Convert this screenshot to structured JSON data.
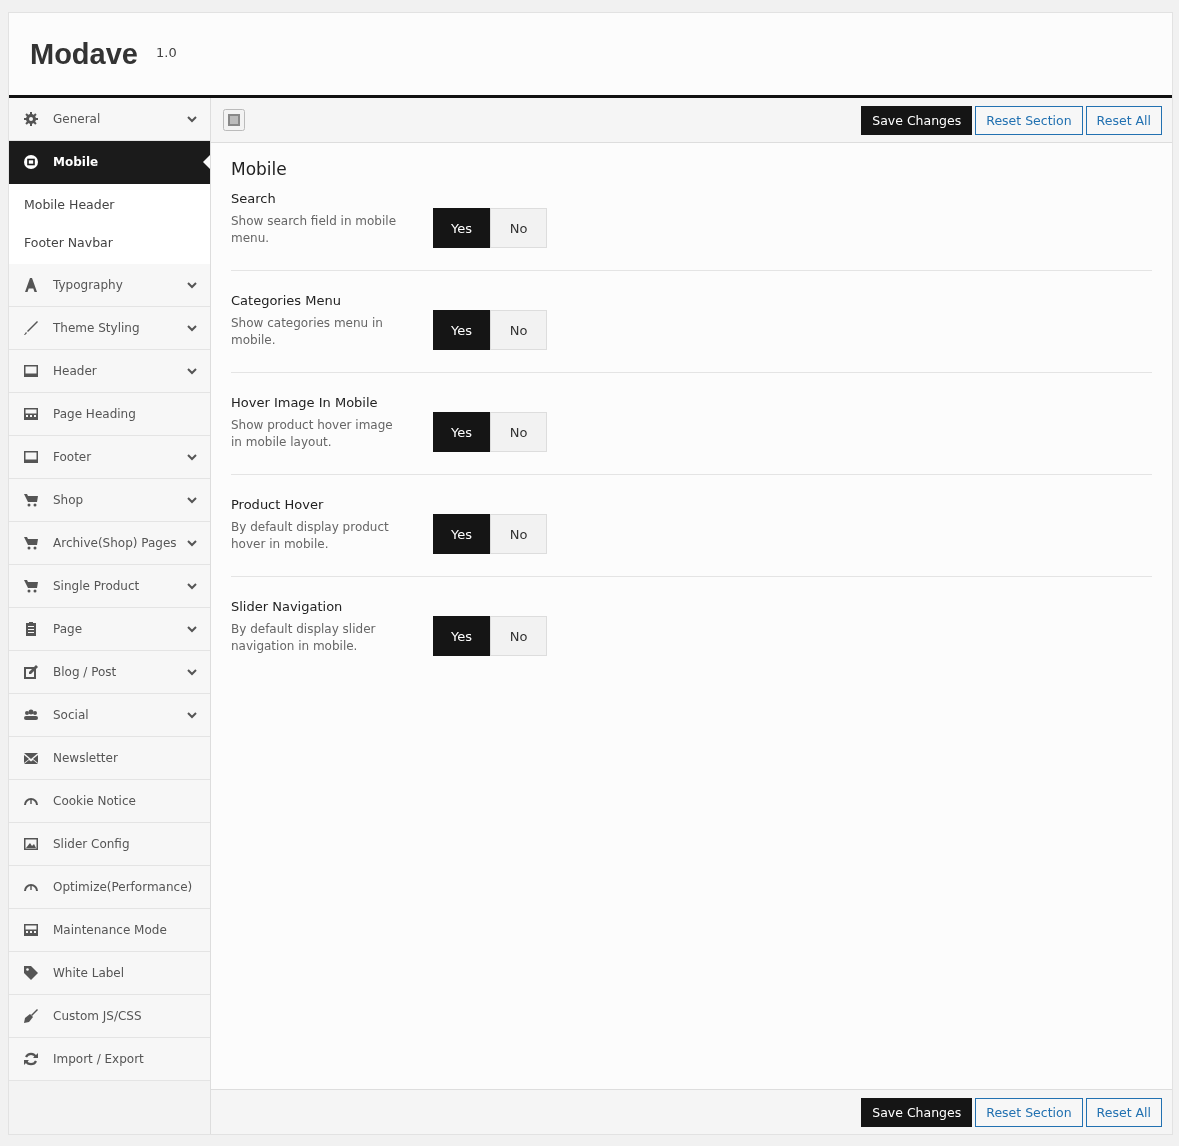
{
  "header": {
    "title": "Modave",
    "version": "1.0"
  },
  "sidebar": {
    "items": [
      {
        "label": "General",
        "expandable": true,
        "selected": false
      },
      {
        "label": "Mobile",
        "expandable": false,
        "selected": true,
        "children": [
          {
            "label": "Mobile Header",
            "selected": false
          },
          {
            "label": "Footer Navbar",
            "selected": false
          }
        ]
      },
      {
        "label": "Typography",
        "expandable": true,
        "selected": false
      },
      {
        "label": "Theme Styling",
        "expandable": true,
        "selected": false
      },
      {
        "label": "Header",
        "expandable": true,
        "selected": false
      },
      {
        "label": "Page Heading",
        "expandable": false,
        "selected": false
      },
      {
        "label": "Footer",
        "expandable": true,
        "selected": false
      },
      {
        "label": "Shop",
        "expandable": true,
        "selected": false
      },
      {
        "label": "Archive(Shop) Pages",
        "expandable": true,
        "selected": false
      },
      {
        "label": "Single Product",
        "expandable": true,
        "selected": false
      },
      {
        "label": "Page",
        "expandable": true,
        "selected": false
      },
      {
        "label": "Blog / Post",
        "expandable": true,
        "selected": false
      },
      {
        "label": "Social",
        "expandable": true,
        "selected": false
      },
      {
        "label": "Newsletter",
        "expandable": false,
        "selected": false
      },
      {
        "label": "Cookie Notice",
        "expandable": false,
        "selected": false
      },
      {
        "label": "Slider Config",
        "expandable": false,
        "selected": false
      },
      {
        "label": "Optimize(Performance)",
        "expandable": false,
        "selected": false
      },
      {
        "label": "Maintenance Mode",
        "expandable": false,
        "selected": false
      },
      {
        "label": "White Label",
        "expandable": false,
        "selected": false
      },
      {
        "label": "Custom JS/CSS",
        "expandable": false,
        "selected": false
      },
      {
        "label": "Import / Export",
        "expandable": false,
        "selected": false
      }
    ]
  },
  "toolbar": {
    "buttons": [
      {
        "label": "Save Changes",
        "kind": "primary"
      },
      {
        "label": "Reset Section",
        "kind": "secondary"
      },
      {
        "label": "Reset All",
        "kind": "secondary"
      }
    ]
  },
  "section": {
    "title": "Mobile",
    "options": [
      {
        "label": "Search",
        "description": "Show search field in mobile menu.",
        "choices": [
          {
            "label": "Yes",
            "selected": true
          },
          {
            "label": "No",
            "selected": false
          }
        ]
      },
      {
        "label": "Categories Menu",
        "description": "Show categories menu in mobile.",
        "choices": [
          {
            "label": "Yes",
            "selected": true
          },
          {
            "label": "No",
            "selected": false
          }
        ]
      },
      {
        "label": "Hover Image In Mobile",
        "description": "Show product hover image in mobile layout.",
        "choices": [
          {
            "label": "Yes",
            "selected": true
          },
          {
            "label": "No",
            "selected": false
          }
        ]
      },
      {
        "label": "Product Hover",
        "description": "By default display product hover in mobile.",
        "choices": [
          {
            "label": "Yes",
            "selected": true
          },
          {
            "label": "No",
            "selected": false
          }
        ]
      },
      {
        "label": "Slider Navigation",
        "description": "By default display slider navigation in mobile.",
        "choices": [
          {
            "label": "Yes",
            "selected": true
          },
          {
            "label": "No",
            "selected": false
          }
        ]
      }
    ]
  },
  "footer": {
    "buttons": [
      {
        "label": "Save Changes",
        "kind": "primary"
      },
      {
        "label": "Reset Section",
        "kind": "secondary"
      },
      {
        "label": "Reset All",
        "kind": "secondary"
      }
    ]
  }
}
